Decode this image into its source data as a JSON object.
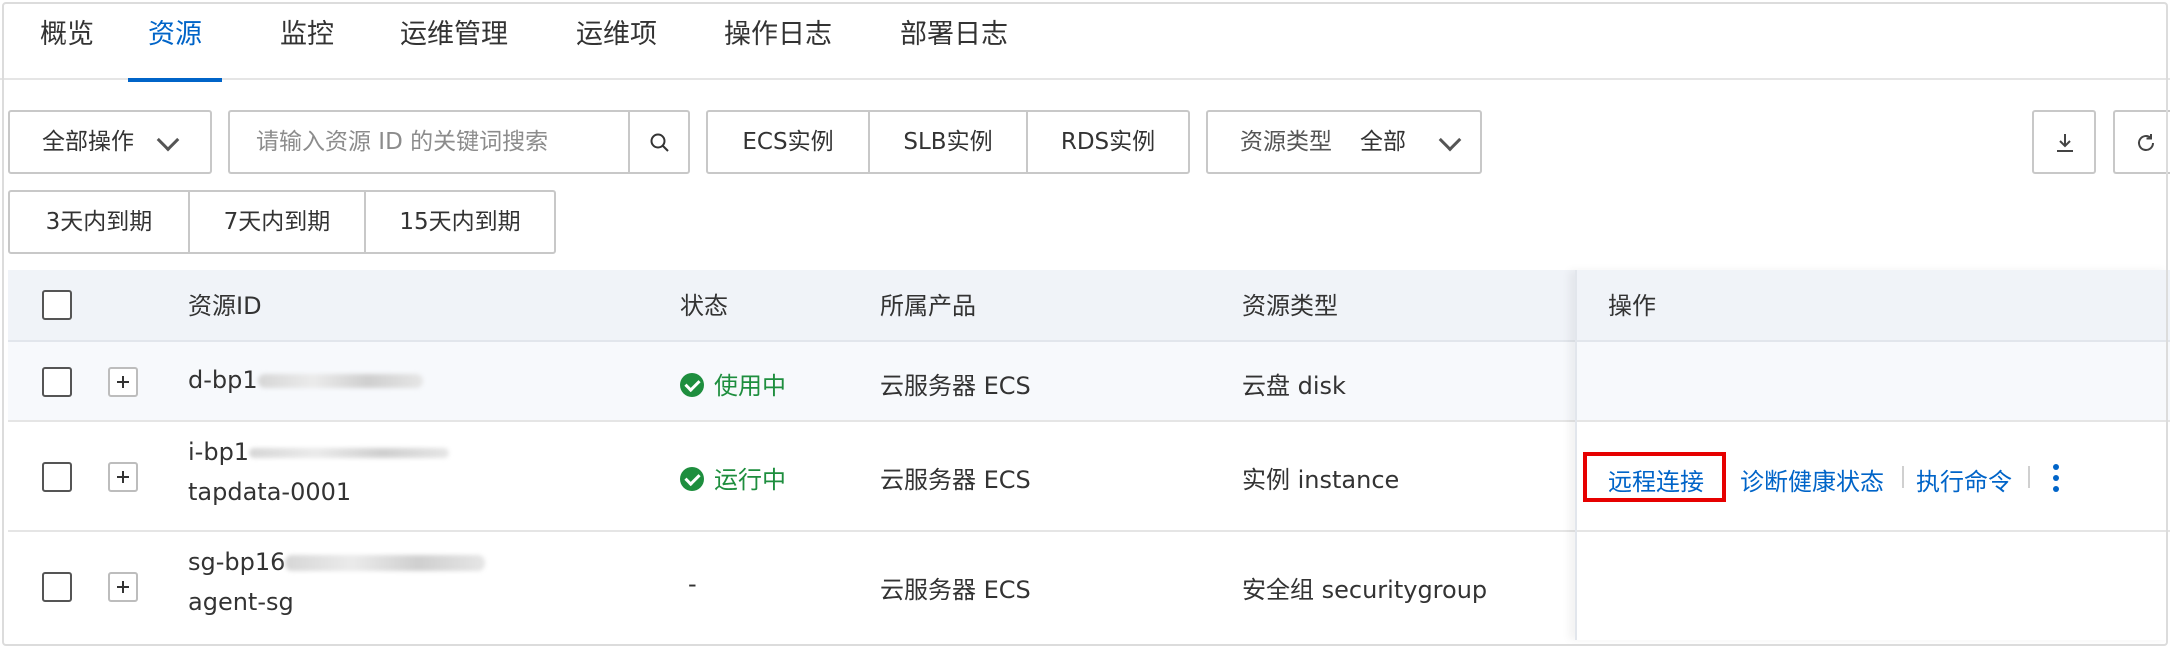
{
  "tabs": [
    {
      "label": "概览"
    },
    {
      "label": "资源",
      "active": true
    },
    {
      "label": "监控"
    },
    {
      "label": "运维管理"
    },
    {
      "label": "运维项"
    },
    {
      "label": "操作日志"
    },
    {
      "label": "部署日志"
    }
  ],
  "toolbar": {
    "all_ops_label": "全部操作",
    "search_placeholder": "请输入资源 ID 的关键词搜索",
    "instance_filters": [
      "ECS实例",
      "SLB实例",
      "RDS实例"
    ],
    "resource_type_label": "资源类型",
    "resource_type_value": "全部",
    "expiry_filters": [
      "3天内到期",
      "7天内到期",
      "15天内到期"
    ]
  },
  "table": {
    "columns": {
      "resource_id": "资源ID",
      "status": "状态",
      "product": "所属产品",
      "resource_type": "资源类型",
      "actions": "操作"
    },
    "rows": [
      {
        "id_prefix": "d-bp1",
        "name": "",
        "status": "使用中",
        "status_ok": true,
        "product": "云服务器 ECS",
        "type": "云盘 disk"
      },
      {
        "id_prefix": "i-bp1",
        "name": "tapdata-0001",
        "status": "运行中",
        "status_ok": true,
        "product": "云服务器 ECS",
        "type": "实例 instance"
      },
      {
        "id_prefix": "sg-bp16",
        "name": "agent-sg",
        "status": "-",
        "status_ok": false,
        "product": "云服务器 ECS",
        "type": "安全组 securitygroup"
      }
    ],
    "row_actions": {
      "remote_connect": "远程连接",
      "diagnose": "诊断健康状态",
      "run_command": "执行命令"
    }
  },
  "colors": {
    "primary": "#0064c8",
    "success": "#1e8e3e",
    "highlight": "#e60000"
  }
}
